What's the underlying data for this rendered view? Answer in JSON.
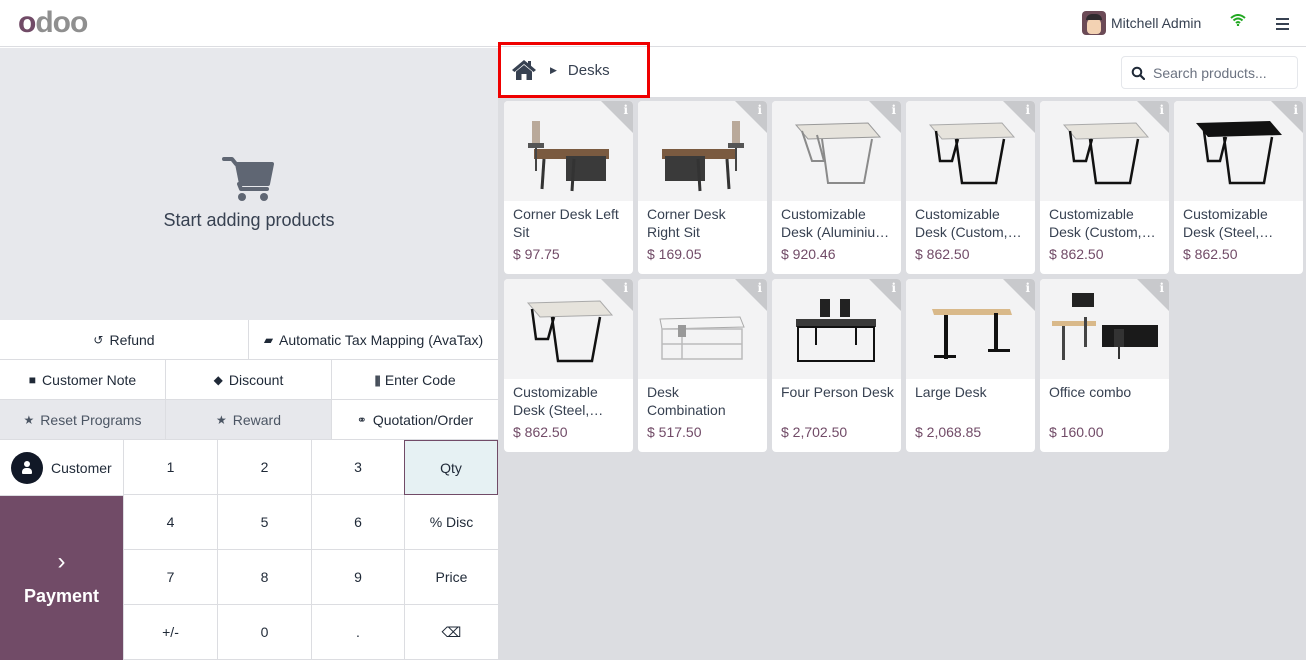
{
  "header": {
    "logo": "odoo",
    "user_name": "Mitchell Admin",
    "icons": [
      "avatar",
      "wifi-icon",
      "menu-icon"
    ]
  },
  "order": {
    "empty_message": "Start adding products"
  },
  "controls": {
    "row1": [
      {
        "label": "Refund",
        "icon": "undo-icon"
      },
      {
        "label": "Automatic Tax Mapping (AvaTax)",
        "icon": "book-icon"
      }
    ],
    "row2": [
      {
        "label": "Customer Note",
        "icon": "note-icon"
      },
      {
        "label": "Discount",
        "icon": "tag-icon"
      },
      {
        "label": "Enter Code",
        "icon": "barcode-icon"
      }
    ],
    "row3": [
      {
        "label": "Reset Programs",
        "icon": "star-icon"
      },
      {
        "label": "Reward",
        "icon": "star-icon"
      },
      {
        "label": "Quotation/Order",
        "icon": "link-icon"
      }
    ]
  },
  "numpad": {
    "customer_label": "Customer",
    "payment_label": "Payment",
    "keys": [
      "1",
      "2",
      "3",
      "Qty",
      "4",
      "5",
      "6",
      "% Disc",
      "7",
      "8",
      "9",
      "Price",
      "+/-",
      "0",
      ".",
      "⌫"
    ],
    "active_key": "Qty"
  },
  "breadcrumb": {
    "home_icon": "home-icon",
    "current": "Desks"
  },
  "search": {
    "placeholder": "Search products..."
  },
  "products": [
    {
      "name": "Corner Desk Left Sit",
      "price": "$ 97.75",
      "image": "corner-desk-left"
    },
    {
      "name": "Corner Desk Right Sit",
      "price": "$ 169.05",
      "image": "corner-desk-right"
    },
    {
      "name": "Customizable Desk (Aluminiu…",
      "price": "$ 920.46",
      "image": "desk-aluminium"
    },
    {
      "name": "Customizable Desk (Custom,…",
      "price": "$ 862.50",
      "image": "desk-custom"
    },
    {
      "name": "Customizable Desk (Custom,…",
      "price": "$ 862.50",
      "image": "desk-custom"
    },
    {
      "name": "Customizable Desk (Steel,…",
      "price": "$ 862.50",
      "image": "desk-steel-black"
    },
    {
      "name": "Customizable Desk (Steel,…",
      "price": "$ 862.50",
      "image": "desk-steel"
    },
    {
      "name": "Desk Combination",
      "price": "$ 517.50",
      "image": "desk-combination"
    },
    {
      "name": "Four Person Desk",
      "price": "$ 2,702.50",
      "image": "four-person-desk"
    },
    {
      "name": "Large Desk",
      "price": "$ 2,068.85",
      "image": "large-desk"
    },
    {
      "name": "Office combo",
      "price": "$ 160.00",
      "image": "office-combo"
    }
  ],
  "colors": {
    "brand": "#714b67",
    "highlight": "#ef0000",
    "active_key_bg": "#e6f1f3",
    "wifi": "#22a822"
  }
}
